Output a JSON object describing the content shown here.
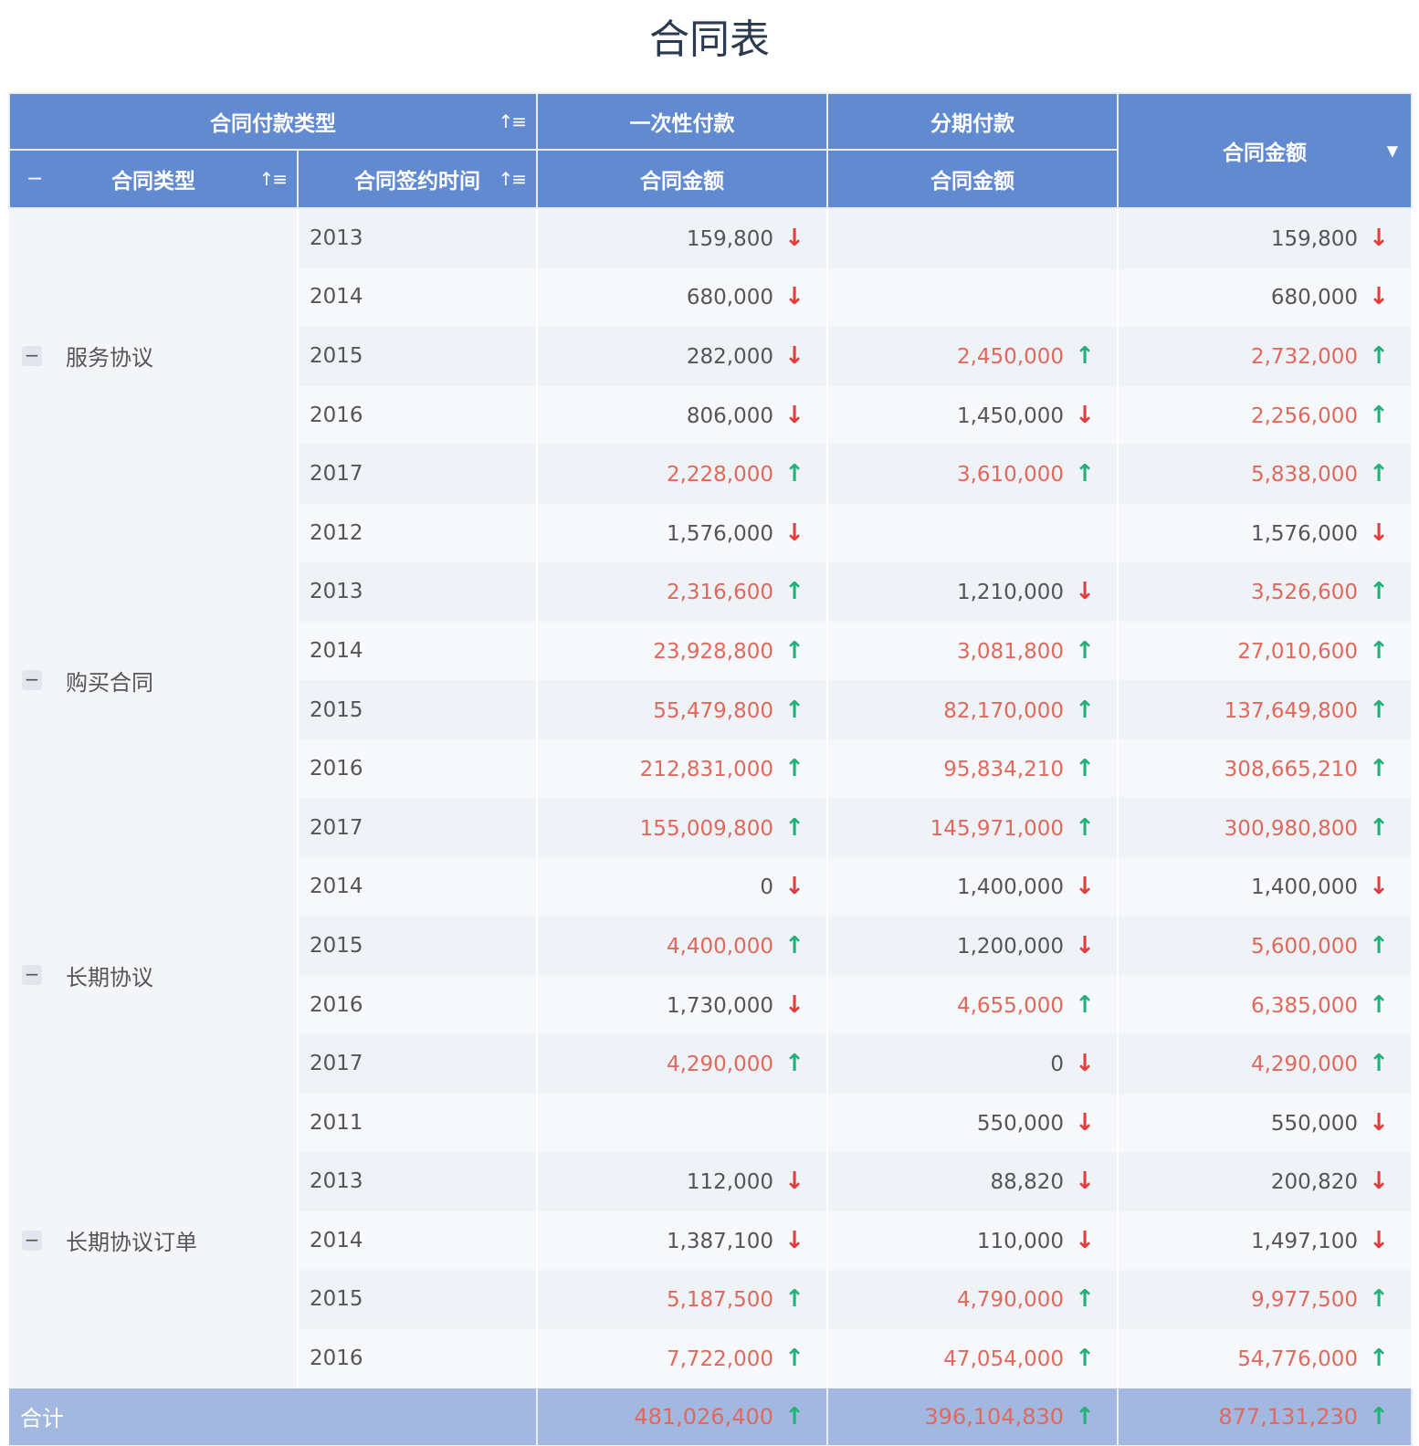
{
  "title": "合同表",
  "header": {
    "payment_type": "合同付款类型",
    "one_time": "一次性付款",
    "installment": "分期付款",
    "contract_type": "合同类型",
    "sign_time": "合同签约时间",
    "amount": "合同金额",
    "total_amount": "合同金额",
    "collapse_symbol": "−",
    "sort_symbol": "↑≡",
    "dropdown_symbol": "▼"
  },
  "arrows": {
    "up": "↑",
    "down": "↓"
  },
  "colors": {
    "header_bg": "#628ad0",
    "total_bg": "#a2b8e1",
    "up": "#22b079",
    "down": "#e23d3d",
    "rise_text": "#e0695c"
  },
  "groups": [
    {
      "name": "服务协议",
      "rows": [
        {
          "year": "2013",
          "one": "159,800",
          "one_dir": "down",
          "inst": "",
          "inst_dir": "",
          "total": "159,800",
          "total_dir": "down"
        },
        {
          "year": "2014",
          "one": "680,000",
          "one_dir": "down",
          "inst": "",
          "inst_dir": "",
          "total": "680,000",
          "total_dir": "down"
        },
        {
          "year": "2015",
          "one": "282,000",
          "one_dir": "down",
          "inst": "2,450,000",
          "inst_dir": "up",
          "total": "2,732,000",
          "total_dir": "up"
        },
        {
          "year": "2016",
          "one": "806,000",
          "one_dir": "down",
          "inst": "1,450,000",
          "inst_dir": "down",
          "total": "2,256,000",
          "total_dir": "up"
        },
        {
          "year": "2017",
          "one": "2,228,000",
          "one_dir": "up",
          "inst": "3,610,000",
          "inst_dir": "up",
          "total": "5,838,000",
          "total_dir": "up"
        }
      ]
    },
    {
      "name": "购买合同",
      "rows": [
        {
          "year": "2012",
          "one": "1,576,000",
          "one_dir": "down",
          "inst": "",
          "inst_dir": "",
          "total": "1,576,000",
          "total_dir": "down"
        },
        {
          "year": "2013",
          "one": "2,316,600",
          "one_dir": "up",
          "inst": "1,210,000",
          "inst_dir": "down",
          "total": "3,526,600",
          "total_dir": "up"
        },
        {
          "year": "2014",
          "one": "23,928,800",
          "one_dir": "up",
          "inst": "3,081,800",
          "inst_dir": "up",
          "total": "27,010,600",
          "total_dir": "up"
        },
        {
          "year": "2015",
          "one": "55,479,800",
          "one_dir": "up",
          "inst": "82,170,000",
          "inst_dir": "up",
          "total": "137,649,800",
          "total_dir": "up"
        },
        {
          "year": "2016",
          "one": "212,831,000",
          "one_dir": "up",
          "inst": "95,834,210",
          "inst_dir": "up",
          "total": "308,665,210",
          "total_dir": "up"
        },
        {
          "year": "2017",
          "one": "155,009,800",
          "one_dir": "up",
          "inst": "145,971,000",
          "inst_dir": "up",
          "total": "300,980,800",
          "total_dir": "up"
        }
      ]
    },
    {
      "name": "长期协议",
      "rows": [
        {
          "year": "2014",
          "one": "0",
          "one_dir": "down",
          "inst": "1,400,000",
          "inst_dir": "down",
          "total": "1,400,000",
          "total_dir": "down"
        },
        {
          "year": "2015",
          "one": "4,400,000",
          "one_dir": "up",
          "inst": "1,200,000",
          "inst_dir": "down",
          "total": "5,600,000",
          "total_dir": "up"
        },
        {
          "year": "2016",
          "one": "1,730,000",
          "one_dir": "down",
          "inst": "4,655,000",
          "inst_dir": "up",
          "total": "6,385,000",
          "total_dir": "up"
        },
        {
          "year": "2017",
          "one": "4,290,000",
          "one_dir": "up",
          "inst": "0",
          "inst_dir": "down",
          "total": "4,290,000",
          "total_dir": "up"
        }
      ]
    },
    {
      "name": "长期协议订单",
      "rows": [
        {
          "year": "2011",
          "one": "",
          "one_dir": "",
          "inst": "550,000",
          "inst_dir": "down",
          "total": "550,000",
          "total_dir": "down"
        },
        {
          "year": "2013",
          "one": "112,000",
          "one_dir": "down",
          "inst": "88,820",
          "inst_dir": "down",
          "total": "200,820",
          "total_dir": "down"
        },
        {
          "year": "2014",
          "one": "1,387,100",
          "one_dir": "down",
          "inst": "110,000",
          "inst_dir": "down",
          "total": "1,497,100",
          "total_dir": "down"
        },
        {
          "year": "2015",
          "one": "5,187,500",
          "one_dir": "up",
          "inst": "4,790,000",
          "inst_dir": "up",
          "total": "9,977,500",
          "total_dir": "up"
        },
        {
          "year": "2016",
          "one": "7,722,000",
          "one_dir": "up",
          "inst": "47,054,000",
          "inst_dir": "up",
          "total": "54,776,000",
          "total_dir": "up"
        }
      ]
    }
  ],
  "total": {
    "label": "合计",
    "one": "481,026,400",
    "one_dir": "up",
    "inst": "396,104,830",
    "inst_dir": "up",
    "total": "877,131,230",
    "total_dir": "up"
  }
}
